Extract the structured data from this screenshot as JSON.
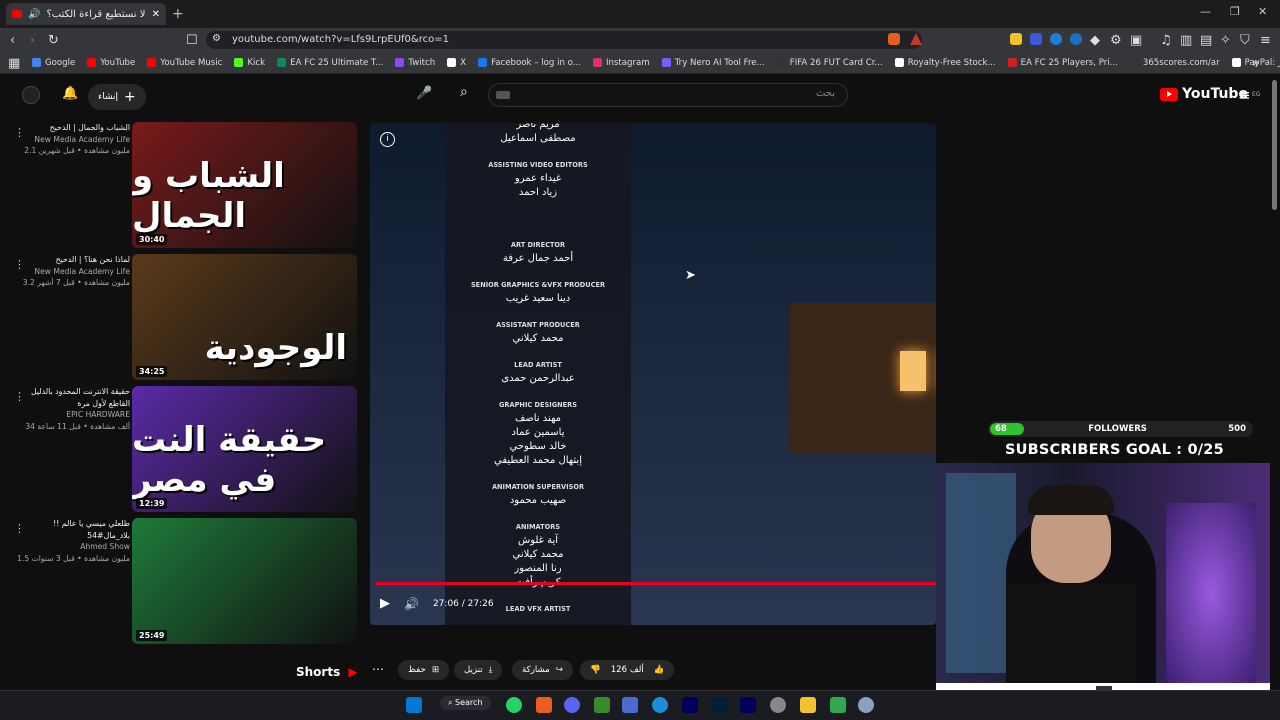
{
  "browser": {
    "tab_title": "لماذا لا نستطيع قراءة الكتب؟ |",
    "url": "youtube.com/watch?v=Lfs9LrpEUf0&rco=1",
    "bookmarks": [
      {
        "label": "Google",
        "color": "#4285f4"
      },
      {
        "label": "YouTube",
        "color": "#ff0000"
      },
      {
        "label": "YouTube Music",
        "color": "#ff0000"
      },
      {
        "label": "Kick",
        "color": "#53fc18"
      },
      {
        "label": "EA FC 25 Ultimate T...",
        "color": "#0d8a5c"
      },
      {
        "label": "Twitch",
        "color": "#9146ff"
      },
      {
        "label": "X",
        "color": "#ffffff"
      },
      {
        "label": "Facebook – log in o...",
        "color": "#1877f2"
      },
      {
        "label": "Instagram",
        "color": "#e1306c"
      },
      {
        "label": "Try Nero AI Tool Fre...",
        "color": "#7a5cff"
      },
      {
        "label": "FIFA 26 FUT Card Cr...",
        "color": "#333333"
      },
      {
        "label": "Royalty-Free Stock...",
        "color": "#ffffff"
      },
      {
        "label": "EA FC 25 Players, Pri...",
        "color": "#d21f1f"
      },
      {
        "label": "365scores.com/ar",
        "color": "#333333"
      },
      {
        "label": "PayPal: الموجز",
        "color": "#ffffff"
      }
    ]
  },
  "youtube": {
    "create_label": "إنشاء",
    "search_placeholder": "بحث",
    "logo_text": "YouTube",
    "logo_suffix": "EG"
  },
  "related": [
    {
      "title": "الشباب والجمال | الدحيح",
      "channel": "New Media Academy Life",
      "meta": "2.1 مليون مشاهدة • قبل شهرين",
      "duration": "30:40",
      "thumb_text": "الشباب و الجمال",
      "bg": "#7a1a1a"
    },
    {
      "title": "لماذا نحن هنا؟ | الدحيح",
      "channel": "New Media Academy Life",
      "meta": "3.2 مليون مشاهدة • قبل 7 أشهر",
      "duration": "34:25",
      "thumb_text": "الوجودية",
      "bg": "#5a3a1a"
    },
    {
      "title": "حقيقة الانترنت المحدود بالدليل القاطع لأول مرة",
      "channel": "EPIC HARDWARE",
      "meta": "34 ألف مشاهدة • قبل 11 ساعة",
      "duration": "12:39",
      "thumb_text": "حقيقة النت في مصر",
      "bg": "#5b2aa8"
    },
    {
      "title": "طلعلي ميسي يا عالم !! بلاد_مال#54",
      "channel": "Ahmed Show",
      "meta": "1.5 مليون مشاهدة • قبل 3 سنوات",
      "duration": "25:49",
      "thumb_text": "",
      "bg": "#1e7a3a"
    }
  ],
  "credits": [
    {
      "role": "",
      "names": [
        "مريم ناصر",
        "مصطفى اسماعيل"
      ]
    },
    {
      "role": "ASSISTING VIDEO EDITORS",
      "names": [
        "غيداء عمرو",
        "زياد احمد"
      ]
    },
    {
      "role": "ART DIRECTOR",
      "names": [
        "أحمد جمال عرفة"
      ]
    },
    {
      "role": "SENIOR GRAPHICS &VFX PRODUCER",
      "names": [
        "دينا سعيد غريب"
      ]
    },
    {
      "role": "ASSISTANT PRODUCER",
      "names": [
        "محمد كيلاني"
      ]
    },
    {
      "role": "LEAD ARTIST",
      "names": [
        "عبدالرحمن حمدى"
      ]
    },
    {
      "role": "GRAPHIC DESIGNERS",
      "names": [
        "مهند ناصف",
        "ياسمين عماد",
        "خالد سطوحي",
        "إبتهال محمد العطيفي"
      ]
    },
    {
      "role": "ANIMATION SUPERVISOR",
      "names": [
        "صهيب محمود"
      ]
    },
    {
      "role": "ANIMATORS",
      "names": [
        "آية غلوش",
        "محمد كيلاني",
        "رنا المنصور",
        "كريم رأفت"
      ]
    },
    {
      "role": "LEAD VFX ARTIST",
      "names": []
    }
  ],
  "player": {
    "time": "27:06 / 27:26",
    "progress": 1.0
  },
  "overlay": {
    "followers_count": "68",
    "followers_label": "FOLLOWERS",
    "followers_goal": "500",
    "followers_progress": 0.136,
    "subs_goal": "SUBSCRIBERS GOAL : 0/25"
  },
  "actions": {
    "like_count": "126 ألف",
    "share": "مشاركة",
    "download": "تنزيل",
    "save": "حفظ",
    "shorts": "Shorts"
  },
  "taskbar": {
    "search": "Search"
  }
}
